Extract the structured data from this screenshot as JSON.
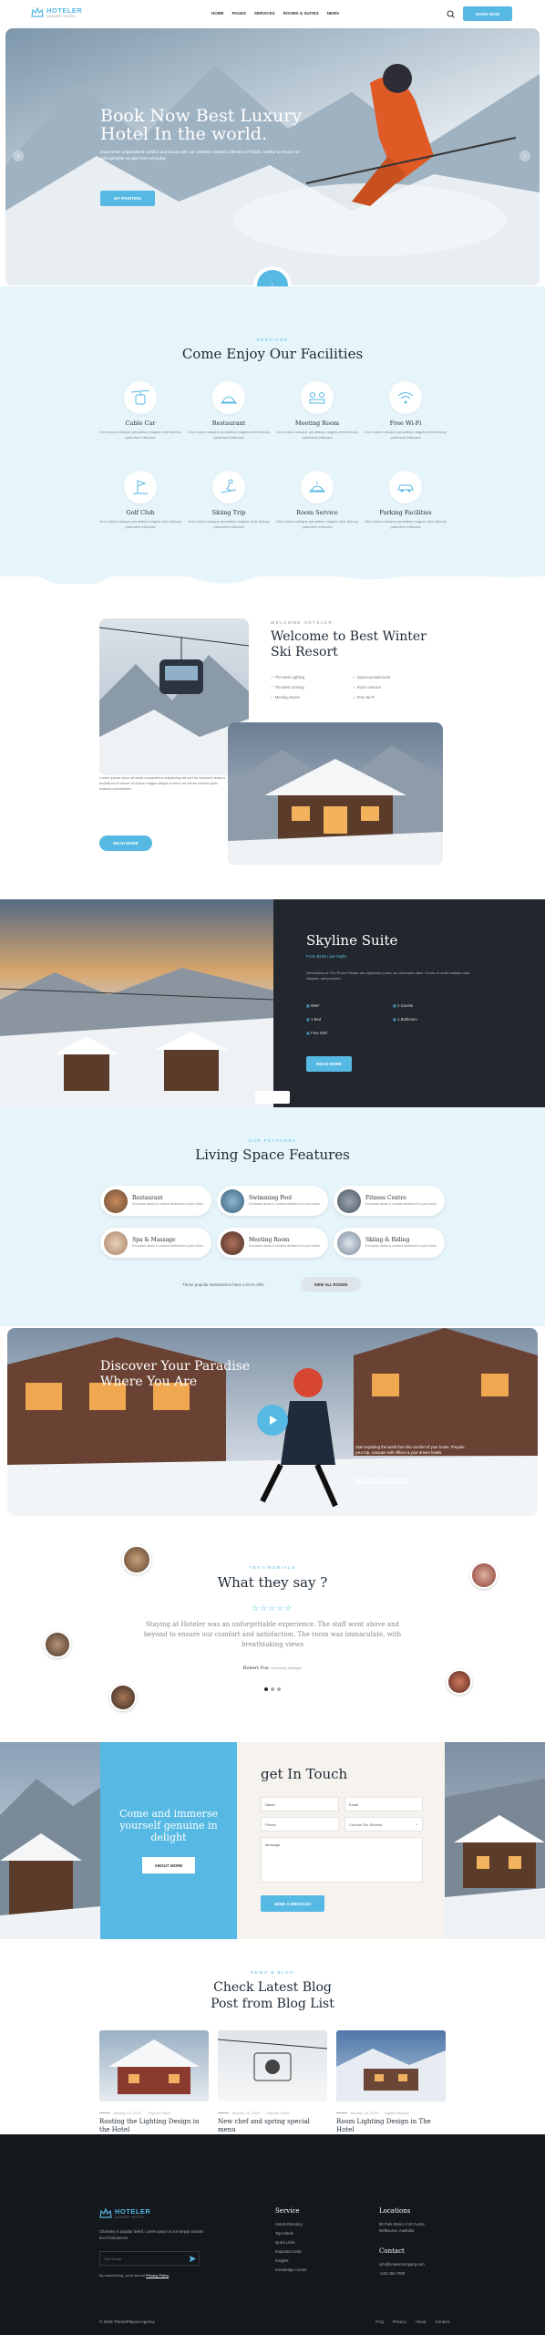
{
  "nav": {
    "logo_name": "HOTELER",
    "logo_sub": "LUXURY HOTEL",
    "items": [
      "HOME",
      "PAGES",
      "SERVICES",
      "ROOMS & SUITES",
      "NEWS"
    ],
    "cta": "BOOK NOW",
    "search_icon": "search-icon"
  },
  "hero": {
    "title": "Book Now Best Luxury Hotel In the world.",
    "desc": "Experience unparalleled comfort and luxury with our carefully curated collection of hotels, crafted to ensure an unforgettable escape from everyday.",
    "button": "MY POSITION"
  },
  "facilities": {
    "eyebrow": "SERVICES",
    "title": "Come Enjoy Our Facilities",
    "items": [
      {
        "title": "Cable Car",
        "desc": "Orci varius natoque penatibus magnis dent dictony parturient inficiosis",
        "icon": "cable-car-icon"
      },
      {
        "title": "Restaurant",
        "desc": "Orci varius natoque penatibus magnis dent dictony parturient inficiosis",
        "icon": "restaurant-icon"
      },
      {
        "title": "Meeting Room",
        "desc": "Orci varius natoque penatibus magnis dent dictony parturient inficiosis",
        "icon": "meeting-room-icon"
      },
      {
        "title": "Free Wi-Fi",
        "desc": "Orci varius natoque penatibus magnis dent dictony parturient inficiosis",
        "icon": "wifi-icon"
      },
      {
        "title": "Golf Club",
        "desc": "Orci varius natoque penatibus magnis dent dictony parturient inficiosis",
        "icon": "golf-icon"
      },
      {
        "title": "Skiing Trip",
        "desc": "Orci varius natoque penatibus magnis dent dictony parturient inficiosis",
        "icon": "skiing-icon"
      },
      {
        "title": "Room Service",
        "desc": "Orci varius natoque penatibus magnis dent dictony parturient inficiosis",
        "icon": "room-service-icon"
      },
      {
        "title": "Parking Facilities",
        "desc": "Orci varius natoque penatibus magnis dent dictony parturient inficiosis",
        "icon": "parking-icon"
      }
    ]
  },
  "welcome": {
    "eyebrow": "WELCOME HOTELER",
    "title": "Welcome to Best Winter Ski Resort",
    "checks": [
      "The Best Lighting",
      "Spacious Bathroom",
      "The Best Serving",
      "Room Service",
      "Meeting Room",
      "Free Wi-Fi"
    ],
    "desc": "Lorem ipsum dolor sit amet consectetur adipiscing elit sed do eiusmod tempor incididunt ut labore et dolore magna aliqua ut enim ad minim veniam quis nostrud exercitation.",
    "button": "READ MORE"
  },
  "suite": {
    "title": "Skyline Suite",
    "price": "From $199 / per Night",
    "desc": "Description of The Room Please are dignissim purus, ac commodo diam. Donec id amet facilisis odio. Aliquam sed posuere.",
    "features": [
      "85m²",
      "2 Guests",
      "1 Bed",
      "1 Bathroom",
      "Free WiFi"
    ],
    "button": "READ MORE"
  },
  "living": {
    "eyebrow": "OUR FEATURES",
    "title": "Living Space Features",
    "items": [
      {
        "title": "Restaurant",
        "desc": "Exclusive deals & content delivered to your inbox"
      },
      {
        "title": "Swimming Pool",
        "desc": "Exclusive deals & content delivered to your inbox"
      },
      {
        "title": "Fitness Centre",
        "desc": "Exclusive deals & content delivered to your inbox"
      },
      {
        "title": "Spa & Massage",
        "desc": "Exclusive deals & content delivered to your inbox"
      },
      {
        "title": "Meeting Room",
        "desc": "Exclusive deals & content delivered to your inbox"
      },
      {
        "title": "Skiing & Riding",
        "desc": "Exclusive deals & content delivered to your inbox"
      }
    ],
    "note": "These popular destinations have a lot to offer",
    "button": "VIEW ALL ROOMS"
  },
  "discover": {
    "title": "Discover Your Paradise Where You Are",
    "desc": "Start exploring the world from the comfort of your home. Prepare your trip, compare with offices & your dream hotels.",
    "link": "GET A FREE CONSULTATION"
  },
  "testimonial": {
    "eyebrow": "TESTIMONIALS",
    "title": "What they say ?",
    "stars": 5,
    "quote": "Staying at Hoteler was an unforgettable experience. The staff went above and beyond to ensure our comfort and satisfaction. The room was immaculate, with breathtaking views",
    "author": "Robert Fox",
    "role": "/ Investing Manager"
  },
  "touch": {
    "promo_title": "Come and immerse yourself genuine in delight",
    "promo_button": "ABOUT MORE",
    "title": "get In Touch",
    "fields": {
      "name": "Name",
      "email": "Email",
      "phone": "Phone",
      "service": "Choose Our Service",
      "message": "Message"
    },
    "button": "SEND A MESSAGE"
  },
  "blog": {
    "eyebrow": "NEWS & BLOG",
    "title": "Check Latest Blog Post from Blog List",
    "posts": [
      {
        "date": "January 14, 2024",
        "cat": "Popular Place",
        "title": "Rooting the Lighting Design in the Hotel"
      },
      {
        "date": "January 16, 2024",
        "cat": "Popular Place",
        "title": "New chef and spring special menu"
      },
      {
        "date": "January 16, 2024",
        "cat": "Digital Festival",
        "title": "Room Lighting Design in The Hotel"
      }
    ]
  },
  "footer": {
    "logo_name": "HOTELER",
    "logo_sub": "LUXURY HOTEL",
    "about": "Chomsky is popular belief, Lorem Ipsum is not simply random text it has pieces",
    "email_placeholder": "Your Email",
    "terms_text": "By subscribing, you'll accept",
    "privacy_link": "Privacy Policy",
    "service_title": "Service",
    "service_links": [
      "Hotels Directory",
      "Top Hotels",
      "Quick Links",
      "Important Links",
      "Insights",
      "Knowledge Center"
    ],
    "locations_title": "Locations",
    "address": "96 Park Street, Fort Fuerte Melbourne, Australia",
    "contact_title": "Contact",
    "email": "info@hotelercompany.com",
    "phone": "+123 456 7890",
    "copyright": "© 2026 ThemePlayout Agency",
    "bottom_links": [
      "FAQ",
      "Privacy",
      "About",
      "Contact"
    ]
  },
  "colors": {
    "accent": "#56b9e3",
    "dark": "#22272e",
    "light_bg": "#e6f5fa"
  }
}
